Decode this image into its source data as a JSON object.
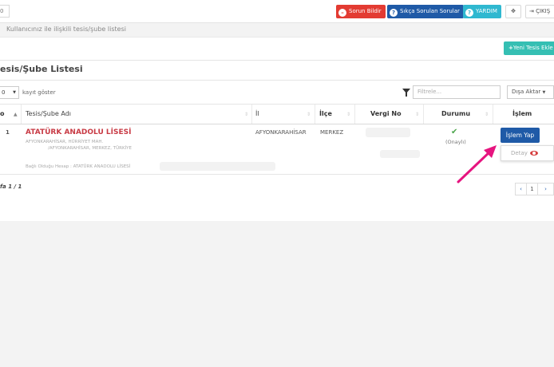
{
  "topbar": {
    "left_box": "0",
    "report_label": "Sorun Bildir",
    "faq_label": "Sıkça Sorulan Sorular",
    "help_label": "YARDIM",
    "logout_label": "ÇIKIŞ"
  },
  "subtitle": "Kullanıcınız ile ilişkili tesis/şube listesi",
  "add_button": "Yeni Tesis Ekle",
  "list_title": "esis/Şube Listesi",
  "controls": {
    "page_length": "0",
    "page_length_text": "kayıt göster",
    "filter_placeholder": "Filtrele...",
    "export_label": "Dışa Aktar"
  },
  "table": {
    "headers": {
      "no": "o",
      "name": "Tesis/Şube Adı",
      "il": "İl",
      "ilce": "İlçe",
      "vergi": "Vergi No",
      "durum": "Durumu",
      "islem": "İşlem"
    },
    "row": {
      "no": "1",
      "name": "ATATÜRK ANADOLU LİSESİ",
      "address_line1": "AFYONKARAHİSAR, HÜRRİYET MAH.",
      "address_line2": "/AFYONKARAHİSAR, MERKEZ, TÜRKİYE",
      "il": "AFYONKARAHİSAR",
      "ilce": "MERKEZ",
      "status": "(Onaylı)",
      "action_label": "İşlem Yap",
      "detail_label": "Detay",
      "linked_account": "Bağlı Olduğu Hesap : ATATÜRK ANADOLU LİSESİ"
    }
  },
  "paging": {
    "info": "fa 1 / 1",
    "prev": "‹",
    "page": "1",
    "next": "›"
  },
  "colors": {
    "red": "#e33b32",
    "blue": "#1f5aa7",
    "cyan": "#2fb8d0",
    "teal": "#35bfb3",
    "school_name": "#c83b45",
    "arrow": "#e6147f"
  }
}
